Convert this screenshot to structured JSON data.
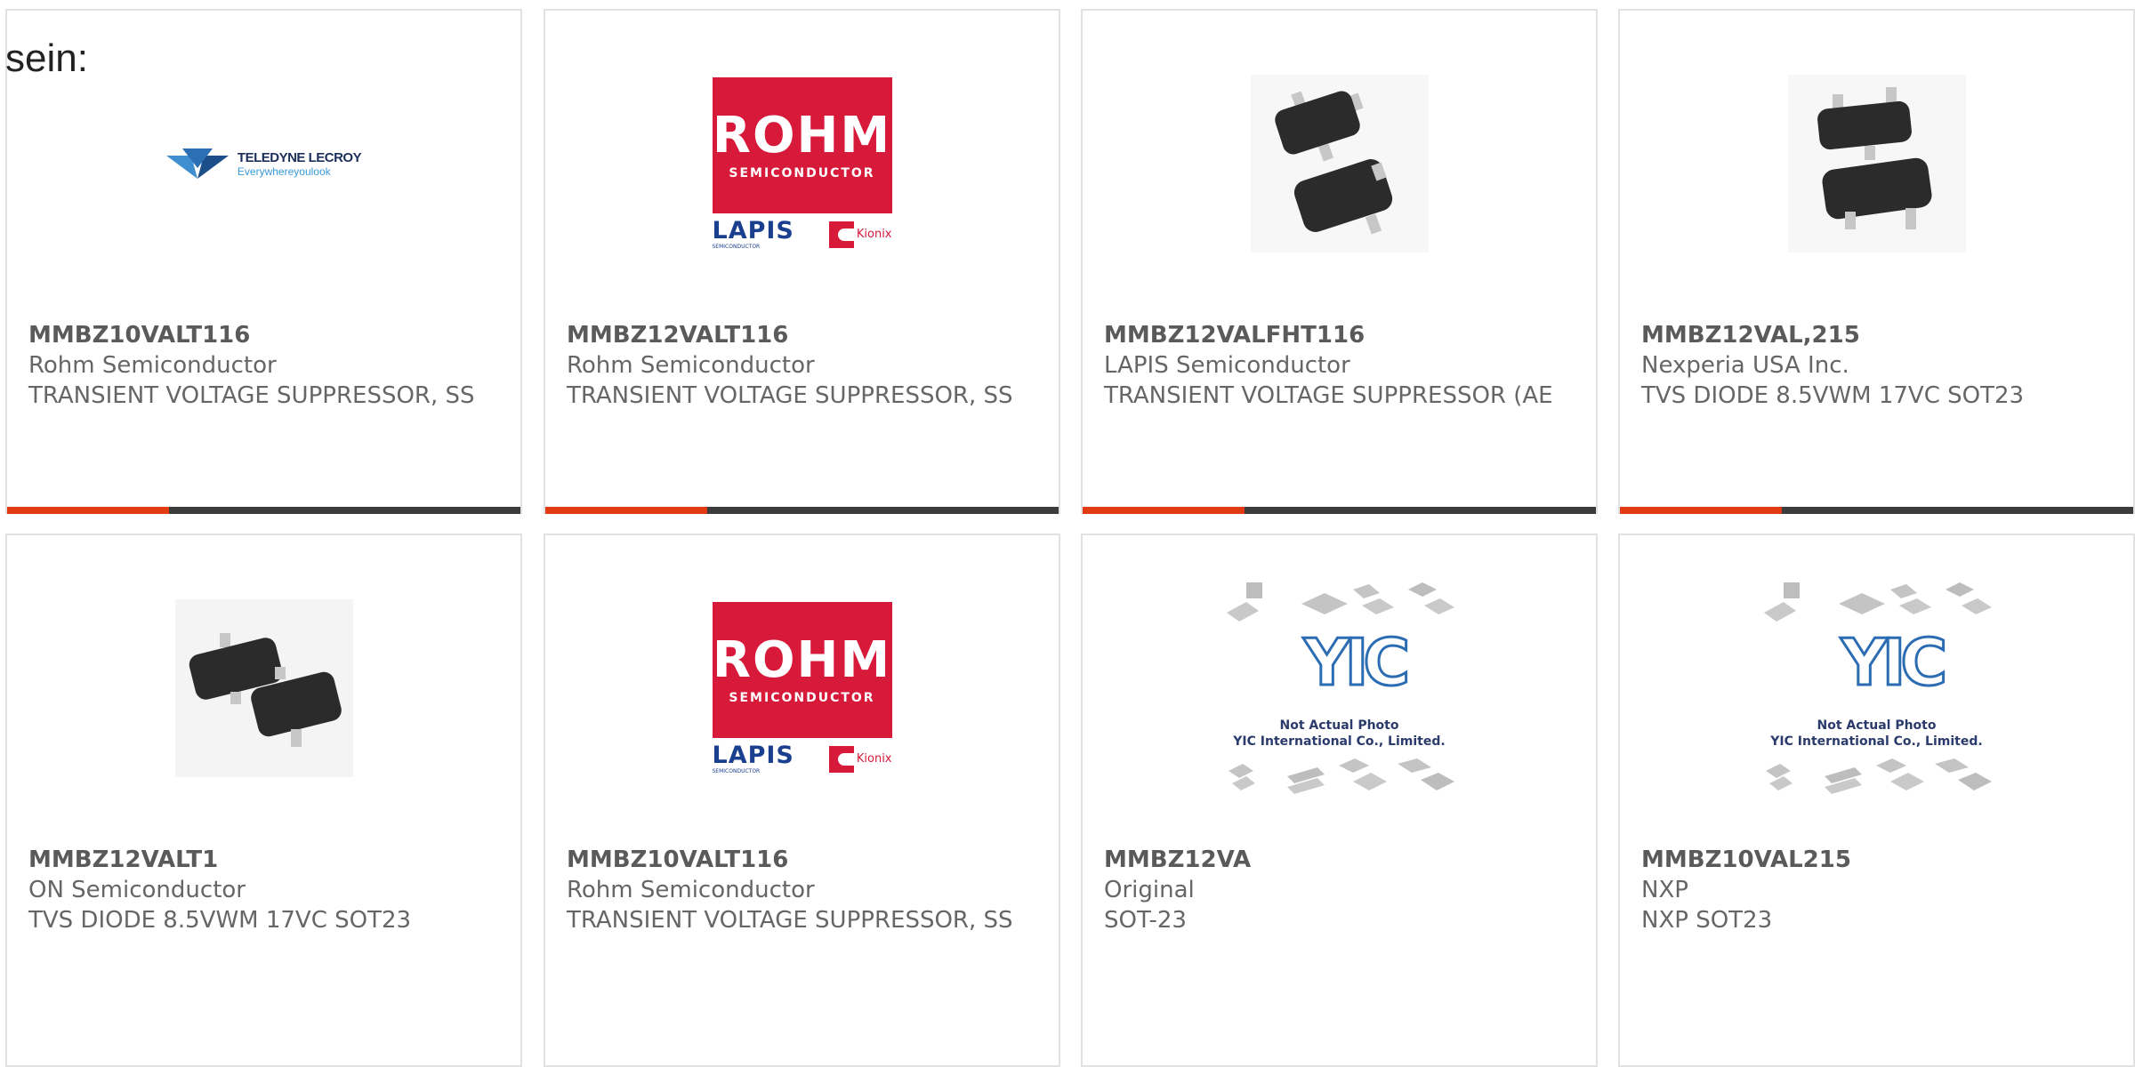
{
  "heading": "sein:",
  "colors": {
    "accent": "#e23a12",
    "bar": "#3c3c3c",
    "card_border": "#e1e1e1",
    "text": "#666666"
  },
  "cards": [
    {
      "part_number": "MMBZ10VALT116",
      "manufacturer": "Rohm Semiconductor",
      "description": "TRANSIENT VOLTAGE SUPPRESSOR, SS",
      "image": "teledyne-lecroy-logo"
    },
    {
      "part_number": "MMBZ12VALT116",
      "manufacturer": "Rohm Semiconductor",
      "description": "TRANSIENT VOLTAGE SUPPRESSOR, SS",
      "image": "rohm-logo"
    },
    {
      "part_number": "MMBZ12VALFHT116",
      "manufacturer": "LAPIS Semiconductor",
      "description": "TRANSIENT VOLTAGE SUPPRESSOR (AE",
      "image": "sot23-package-photo"
    },
    {
      "part_number": "MMBZ12VAL,215",
      "manufacturer": "Nexperia USA Inc.",
      "description": "TVS DIODE 8.5VWM 17VC SOT23",
      "image": "sot23-package-photo"
    },
    {
      "part_number": "MMBZ12VALT1",
      "manufacturer": "ON Semiconductor",
      "description": "TVS DIODE 8.5VWM 17VC SOT23",
      "image": "sot23-package-photo"
    },
    {
      "part_number": "MMBZ10VALT116",
      "manufacturer": "Rohm Semiconductor",
      "description": "TRANSIENT VOLTAGE SUPPRESSOR, SS",
      "image": "rohm-logo"
    },
    {
      "part_number": "MMBZ12VA",
      "manufacturer": "Original",
      "description": "SOT-23",
      "image": "yic-placeholder"
    },
    {
      "part_number": "MMBZ10VAL215",
      "manufacturer": "NXP",
      "description": "NXP SOT23",
      "image": "yic-placeholder"
    }
  ],
  "logos": {
    "teledyne_brand": "TELEDYNE LECROY",
    "teledyne_tagline": "Everywhereyoulook",
    "rohm_name": "ROHM",
    "rohm_sub": "SEMICONDUCTOR",
    "lapis_name": "LAPIS",
    "lapis_sub": "SEMICONDUCTOR",
    "kionix_name": "Kionix",
    "yic_mark": "YIC",
    "yic_note_1": "Not Actual Photo",
    "yic_note_2": "YIC International Co., Limited."
  }
}
